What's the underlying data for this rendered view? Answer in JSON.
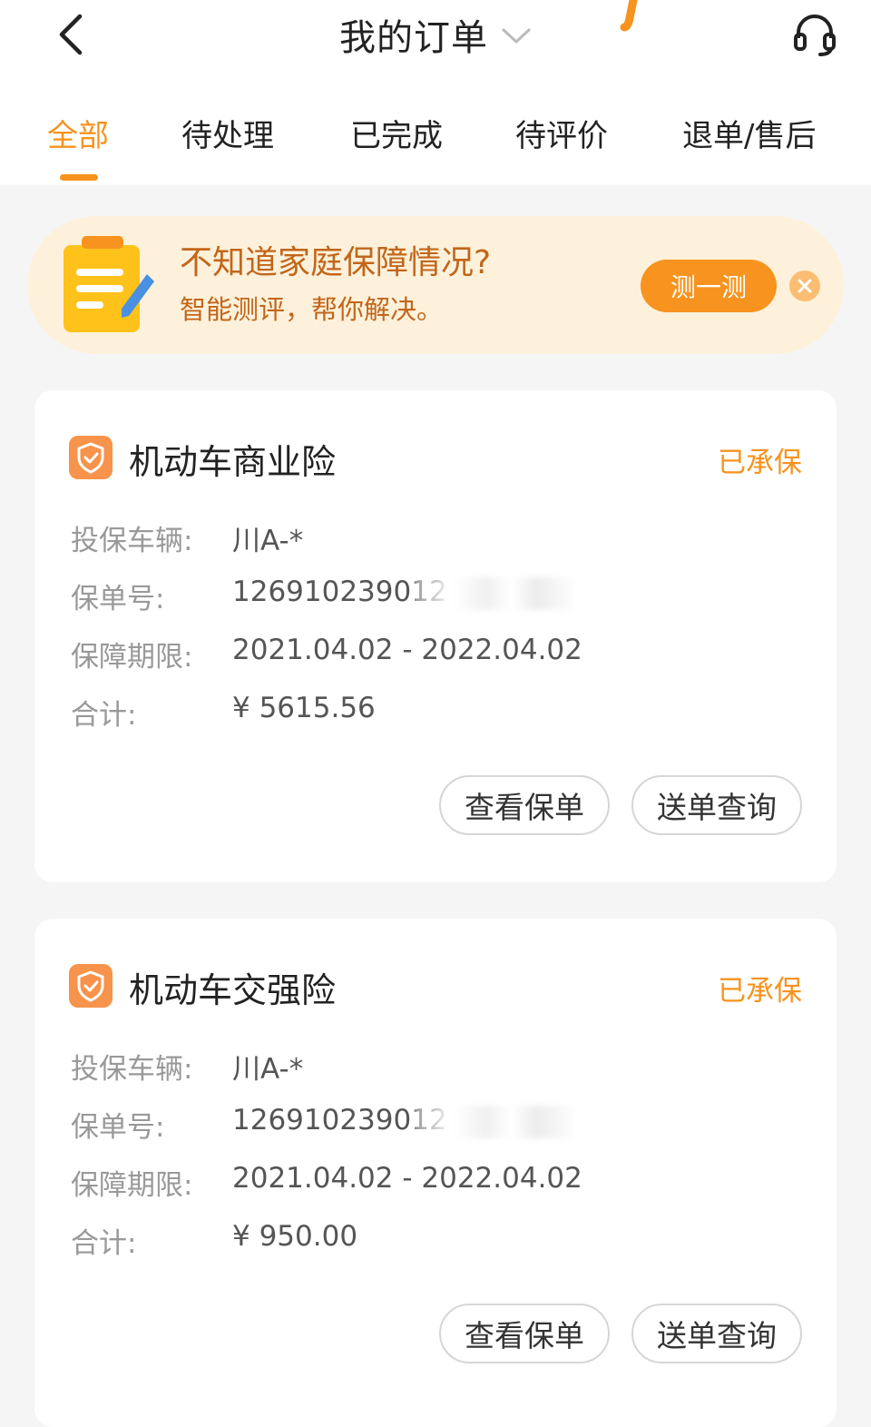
{
  "header": {
    "title": "我的订单",
    "accent_color": "#f7931e"
  },
  "tabs": [
    {
      "label": "全部",
      "active": true
    },
    {
      "label": "待处理",
      "active": false
    },
    {
      "label": "已完成",
      "active": false
    },
    {
      "label": "待评价",
      "active": false
    },
    {
      "label": "退单/售后",
      "active": false
    }
  ],
  "banner": {
    "title": "不知道家庭保障情况?",
    "subtitle": "智能测评，帮你解决。",
    "button_label": "测一测",
    "icon": "notepad-pencil-icon"
  },
  "orders": [
    {
      "title": "机动车商业险",
      "status": "已承保",
      "vehicle_label": "投保车辆:",
      "vehicle_value": "川A-*",
      "policy_label": "保单号:",
      "policy_value": "126910239012",
      "period_label": "保障期限:",
      "period_value": "2021.04.02 - 2022.04.02",
      "total_label": "合计:",
      "total_value": "¥ 5615.56",
      "view_button": "查看保单",
      "track_button": "送单查询"
    },
    {
      "title": "机动车交强险",
      "status": "已承保",
      "vehicle_label": "投保车辆:",
      "vehicle_value": "川A-*",
      "policy_label": "保单号:",
      "policy_value": "126910239012",
      "period_label": "保障期限:",
      "period_value": "2021.04.02 - 2022.04.02",
      "total_label": "合计:",
      "total_value": "¥ 950.00",
      "view_button": "查看保单",
      "track_button": "送单查询"
    }
  ]
}
